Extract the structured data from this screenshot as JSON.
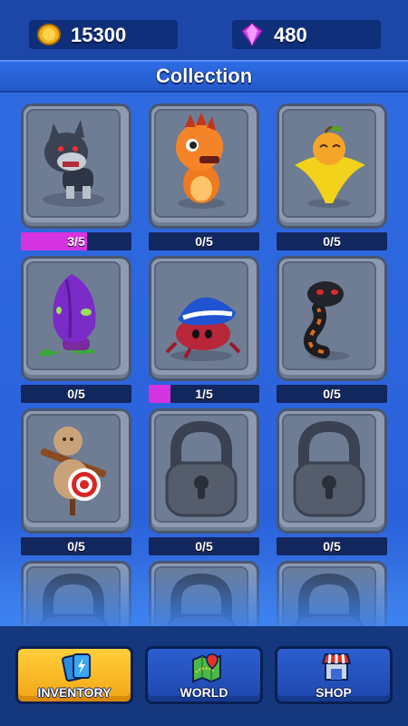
{
  "currencies": {
    "coins": {
      "value": "15300",
      "icon": "gold-coin-icon"
    },
    "gems": {
      "value": "480",
      "icon": "purple-gem-icon"
    }
  },
  "title": "Collection",
  "cards": [
    {
      "name": "wolf",
      "progress": "3/5",
      "fraction": 0.6,
      "locked": false
    },
    {
      "name": "orange-dragon",
      "progress": "0/5",
      "fraction": 0,
      "locked": false
    },
    {
      "name": "yellow-fruit-bird",
      "progress": "0/5",
      "fraction": 0,
      "locked": false
    },
    {
      "name": "purple-bulb-plant",
      "progress": "0/5",
      "fraction": 0,
      "locked": false
    },
    {
      "name": "blue-shell-crab",
      "progress": "1/5",
      "fraction": 0.2,
      "locked": false
    },
    {
      "name": "black-snake",
      "progress": "0/5",
      "fraction": 0,
      "locked": false
    },
    {
      "name": "target-dummy",
      "progress": "0/5",
      "fraction": 0,
      "locked": false
    },
    {
      "name": "locked",
      "progress": "0/5",
      "fraction": 0,
      "locked": true
    },
    {
      "name": "locked",
      "progress": "0/5",
      "fraction": 0,
      "locked": true
    }
  ],
  "nav": {
    "inventory": "INVENTORY",
    "world": "WORLD",
    "shop": "SHOP"
  },
  "colors": {
    "background": "#2a62db",
    "progress_fill": "#d633e0",
    "active_tab": "#f5b020"
  }
}
